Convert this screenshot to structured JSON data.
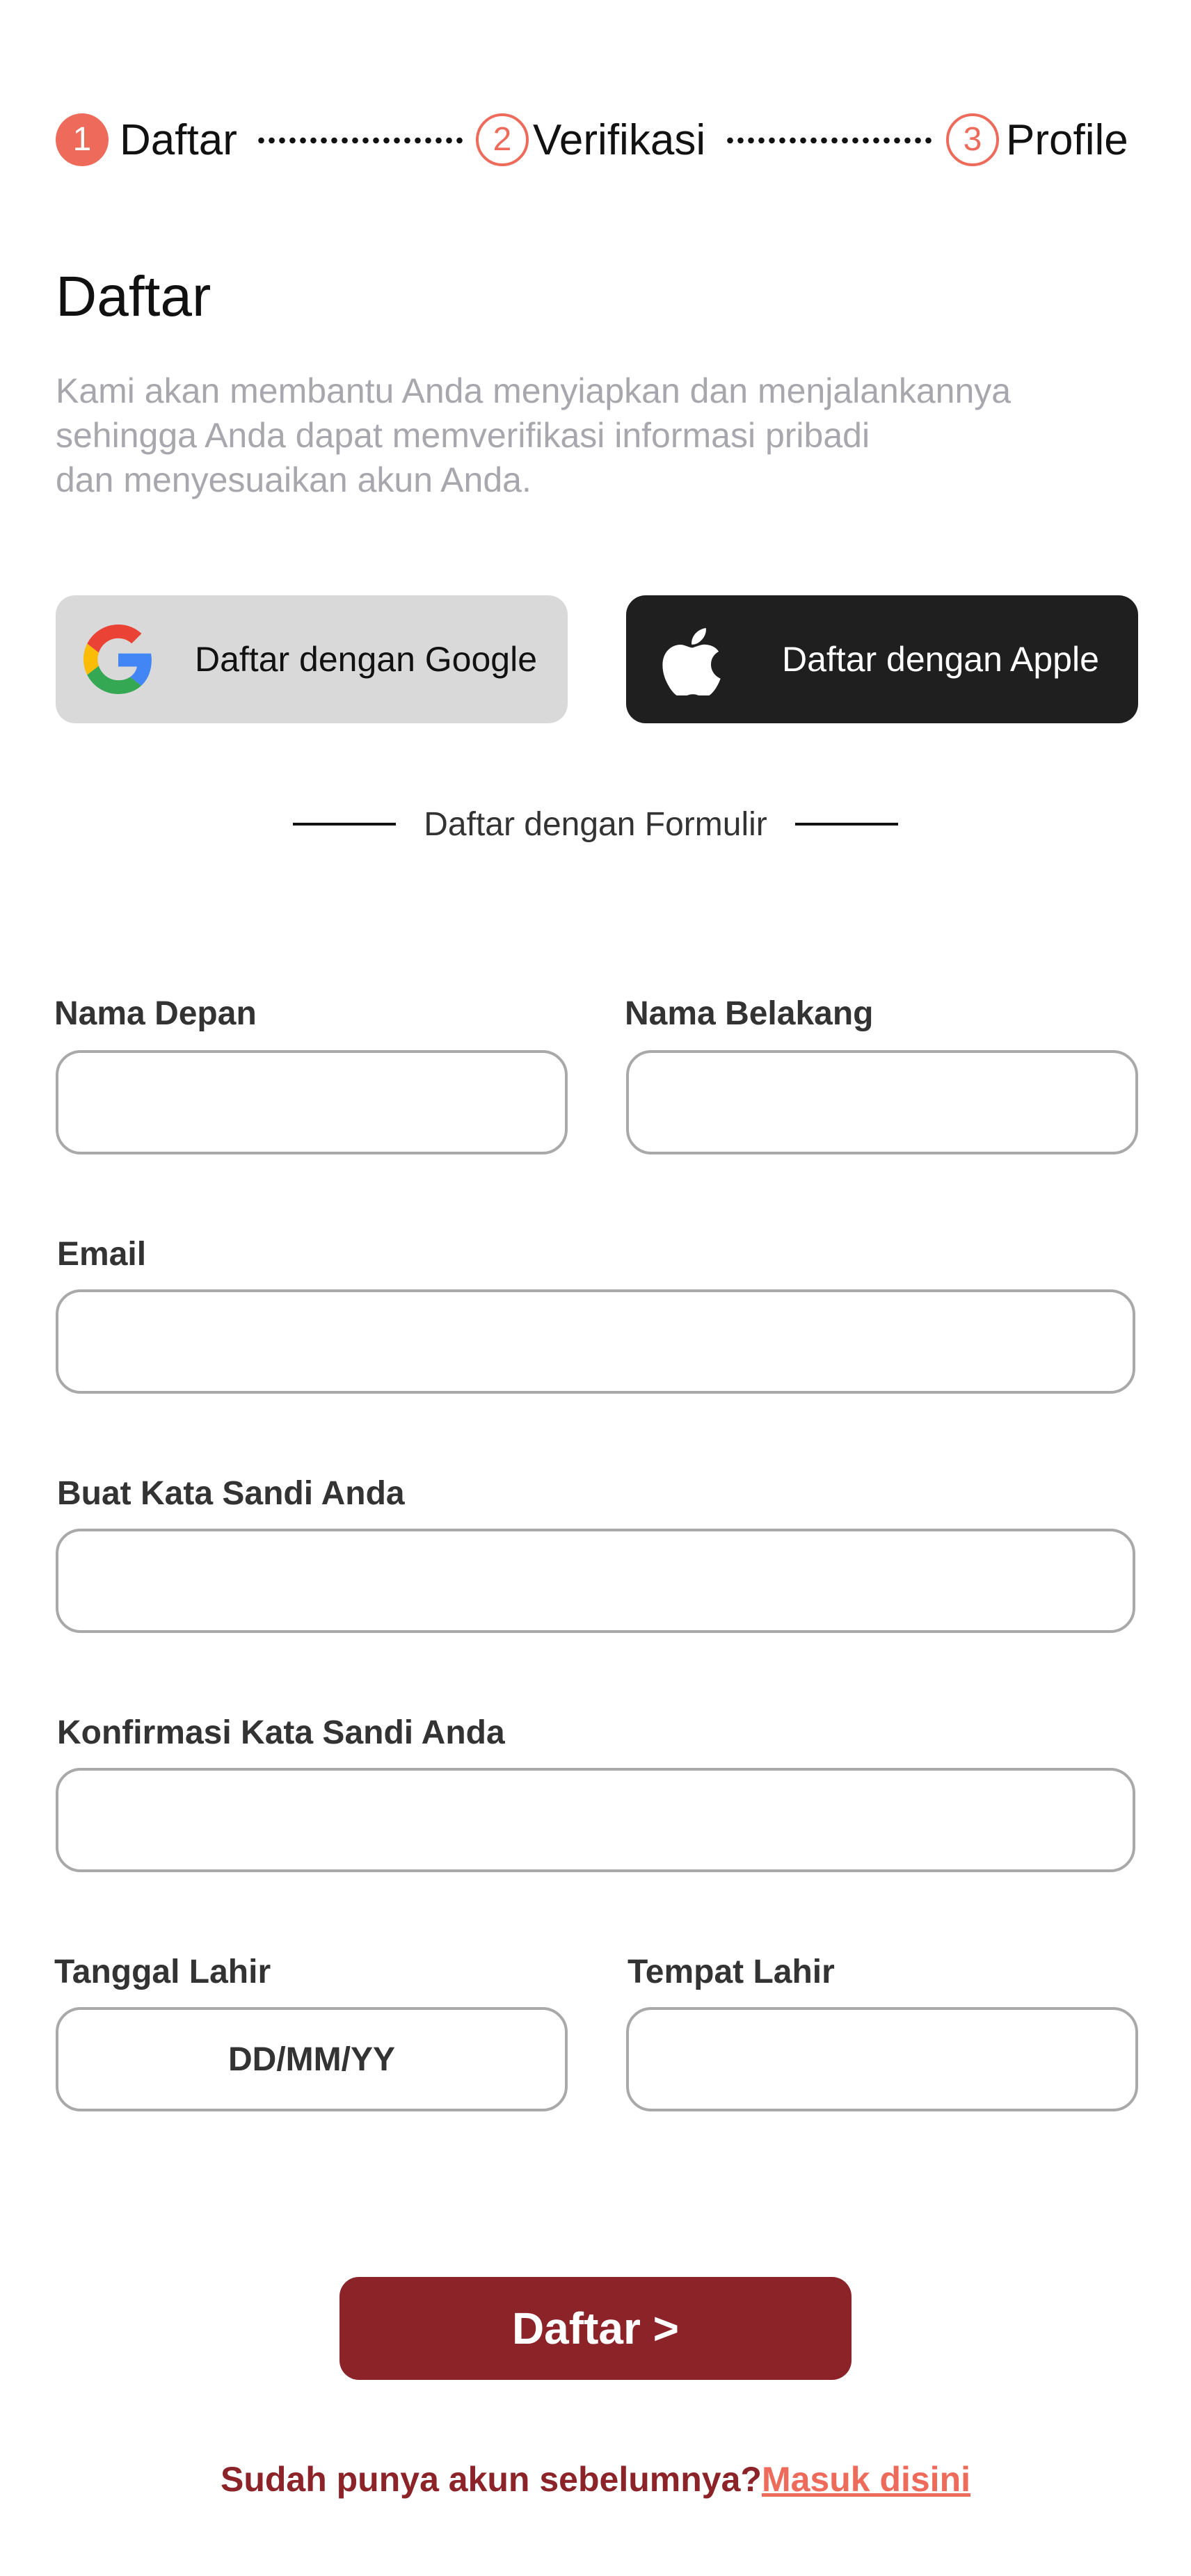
{
  "stepper": {
    "steps": [
      {
        "number": "1",
        "label": "Daftar",
        "state": "active"
      },
      {
        "number": "2",
        "label": "Verifikasi",
        "state": "inactive"
      },
      {
        "number": "3",
        "label": "Profile",
        "state": "inactive"
      }
    ],
    "accent_color": "#EE6B5B"
  },
  "header": {
    "title": "Daftar",
    "subtitle": "Kami akan membantu Anda menyiapkan dan menjalankannya\nsehingga Anda dapat memverifikasi informasi pribadi\ndan menyesuaikan akun Anda."
  },
  "social": {
    "google": {
      "label": "Daftar dengan Google",
      "icon": "google-icon",
      "bg_color": "#d9d9d9"
    },
    "apple": {
      "label": "Daftar dengan Apple",
      "icon": "apple-icon",
      "bg_color": "#1f1f1f"
    }
  },
  "divider": {
    "text": "Daftar dengan Formulir"
  },
  "form": {
    "first_name": {
      "label": "Nama Depan",
      "value": "",
      "placeholder": ""
    },
    "last_name": {
      "label": "Nama Belakang",
      "value": "",
      "placeholder": ""
    },
    "email": {
      "label": "Email",
      "value": "",
      "placeholder": ""
    },
    "password": {
      "label": "Buat Kata Sandi Anda",
      "value": "",
      "placeholder": ""
    },
    "confirm_password": {
      "label": "Konfirmasi Kata Sandi Anda",
      "value": "",
      "placeholder": ""
    },
    "birth_date": {
      "label": "Tanggal Lahir",
      "value": "",
      "placeholder": "DD/MM/YY"
    },
    "birth_place": {
      "label": "Tempat Lahir",
      "value": "",
      "placeholder": ""
    }
  },
  "submit": {
    "label": "Daftar >",
    "bg_color": "#8b2329"
  },
  "footer": {
    "question": "Sudah punya akun sebelumnya?",
    "link": "Masuk disini"
  }
}
